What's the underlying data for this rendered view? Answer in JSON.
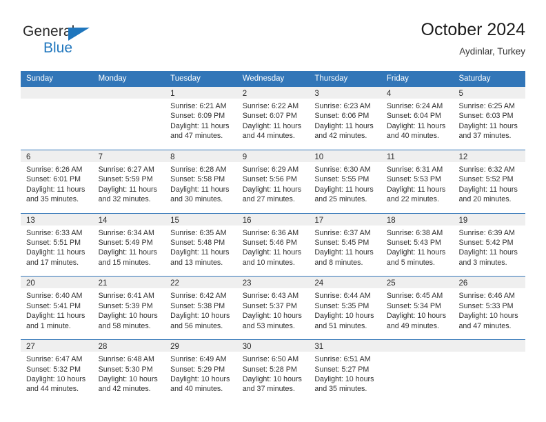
{
  "logo": {
    "word_one": "General",
    "word_two": "Blue",
    "triangle_icon": "triangle-icon",
    "brand_color": "#1f76bd"
  },
  "header": {
    "title": "October 2024",
    "location": "Aydinlar, Turkey"
  },
  "calendar": {
    "header_color": "#3276b8",
    "daynum_band_color": "#efefef",
    "weekday_headers": [
      "Sunday",
      "Monday",
      "Tuesday",
      "Wednesday",
      "Thursday",
      "Friday",
      "Saturday"
    ],
    "weeks": [
      [
        {
          "day": "",
          "lines": []
        },
        {
          "day": "",
          "lines": []
        },
        {
          "day": "1",
          "lines": [
            "Sunrise: 6:21 AM",
            "Sunset: 6:09 PM",
            "Daylight: 11 hours",
            "and 47 minutes."
          ]
        },
        {
          "day": "2",
          "lines": [
            "Sunrise: 6:22 AM",
            "Sunset: 6:07 PM",
            "Daylight: 11 hours",
            "and 44 minutes."
          ]
        },
        {
          "day": "3",
          "lines": [
            "Sunrise: 6:23 AM",
            "Sunset: 6:06 PM",
            "Daylight: 11 hours",
            "and 42 minutes."
          ]
        },
        {
          "day": "4",
          "lines": [
            "Sunrise: 6:24 AM",
            "Sunset: 6:04 PM",
            "Daylight: 11 hours",
            "and 40 minutes."
          ]
        },
        {
          "day": "5",
          "lines": [
            "Sunrise: 6:25 AM",
            "Sunset: 6:03 PM",
            "Daylight: 11 hours",
            "and 37 minutes."
          ]
        }
      ],
      [
        {
          "day": "6",
          "lines": [
            "Sunrise: 6:26 AM",
            "Sunset: 6:01 PM",
            "Daylight: 11 hours",
            "and 35 minutes."
          ]
        },
        {
          "day": "7",
          "lines": [
            "Sunrise: 6:27 AM",
            "Sunset: 5:59 PM",
            "Daylight: 11 hours",
            "and 32 minutes."
          ]
        },
        {
          "day": "8",
          "lines": [
            "Sunrise: 6:28 AM",
            "Sunset: 5:58 PM",
            "Daylight: 11 hours",
            "and 30 minutes."
          ]
        },
        {
          "day": "9",
          "lines": [
            "Sunrise: 6:29 AM",
            "Sunset: 5:56 PM",
            "Daylight: 11 hours",
            "and 27 minutes."
          ]
        },
        {
          "day": "10",
          "lines": [
            "Sunrise: 6:30 AM",
            "Sunset: 5:55 PM",
            "Daylight: 11 hours",
            "and 25 minutes."
          ]
        },
        {
          "day": "11",
          "lines": [
            "Sunrise: 6:31 AM",
            "Sunset: 5:53 PM",
            "Daylight: 11 hours",
            "and 22 minutes."
          ]
        },
        {
          "day": "12",
          "lines": [
            "Sunrise: 6:32 AM",
            "Sunset: 5:52 PM",
            "Daylight: 11 hours",
            "and 20 minutes."
          ]
        }
      ],
      [
        {
          "day": "13",
          "lines": [
            "Sunrise: 6:33 AM",
            "Sunset: 5:51 PM",
            "Daylight: 11 hours",
            "and 17 minutes."
          ]
        },
        {
          "day": "14",
          "lines": [
            "Sunrise: 6:34 AM",
            "Sunset: 5:49 PM",
            "Daylight: 11 hours",
            "and 15 minutes."
          ]
        },
        {
          "day": "15",
          "lines": [
            "Sunrise: 6:35 AM",
            "Sunset: 5:48 PM",
            "Daylight: 11 hours",
            "and 13 minutes."
          ]
        },
        {
          "day": "16",
          "lines": [
            "Sunrise: 6:36 AM",
            "Sunset: 5:46 PM",
            "Daylight: 11 hours",
            "and 10 minutes."
          ]
        },
        {
          "day": "17",
          "lines": [
            "Sunrise: 6:37 AM",
            "Sunset: 5:45 PM",
            "Daylight: 11 hours",
            "and 8 minutes."
          ]
        },
        {
          "day": "18",
          "lines": [
            "Sunrise: 6:38 AM",
            "Sunset: 5:43 PM",
            "Daylight: 11 hours",
            "and 5 minutes."
          ]
        },
        {
          "day": "19",
          "lines": [
            "Sunrise: 6:39 AM",
            "Sunset: 5:42 PM",
            "Daylight: 11 hours",
            "and 3 minutes."
          ]
        }
      ],
      [
        {
          "day": "20",
          "lines": [
            "Sunrise: 6:40 AM",
            "Sunset: 5:41 PM",
            "Daylight: 11 hours",
            "and 1 minute."
          ]
        },
        {
          "day": "21",
          "lines": [
            "Sunrise: 6:41 AM",
            "Sunset: 5:39 PM",
            "Daylight: 10 hours",
            "and 58 minutes."
          ]
        },
        {
          "day": "22",
          "lines": [
            "Sunrise: 6:42 AM",
            "Sunset: 5:38 PM",
            "Daylight: 10 hours",
            "and 56 minutes."
          ]
        },
        {
          "day": "23",
          "lines": [
            "Sunrise: 6:43 AM",
            "Sunset: 5:37 PM",
            "Daylight: 10 hours",
            "and 53 minutes."
          ]
        },
        {
          "day": "24",
          "lines": [
            "Sunrise: 6:44 AM",
            "Sunset: 5:35 PM",
            "Daylight: 10 hours",
            "and 51 minutes."
          ]
        },
        {
          "day": "25",
          "lines": [
            "Sunrise: 6:45 AM",
            "Sunset: 5:34 PM",
            "Daylight: 10 hours",
            "and 49 minutes."
          ]
        },
        {
          "day": "26",
          "lines": [
            "Sunrise: 6:46 AM",
            "Sunset: 5:33 PM",
            "Daylight: 10 hours",
            "and 47 minutes."
          ]
        }
      ],
      [
        {
          "day": "27",
          "lines": [
            "Sunrise: 6:47 AM",
            "Sunset: 5:32 PM",
            "Daylight: 10 hours",
            "and 44 minutes."
          ]
        },
        {
          "day": "28",
          "lines": [
            "Sunrise: 6:48 AM",
            "Sunset: 5:30 PM",
            "Daylight: 10 hours",
            "and 42 minutes."
          ]
        },
        {
          "day": "29",
          "lines": [
            "Sunrise: 6:49 AM",
            "Sunset: 5:29 PM",
            "Daylight: 10 hours",
            "and 40 minutes."
          ]
        },
        {
          "day": "30",
          "lines": [
            "Sunrise: 6:50 AM",
            "Sunset: 5:28 PM",
            "Daylight: 10 hours",
            "and 37 minutes."
          ]
        },
        {
          "day": "31",
          "lines": [
            "Sunrise: 6:51 AM",
            "Sunset: 5:27 PM",
            "Daylight: 10 hours",
            "and 35 minutes."
          ]
        },
        {
          "day": "",
          "lines": []
        },
        {
          "day": "",
          "lines": []
        }
      ]
    ]
  }
}
